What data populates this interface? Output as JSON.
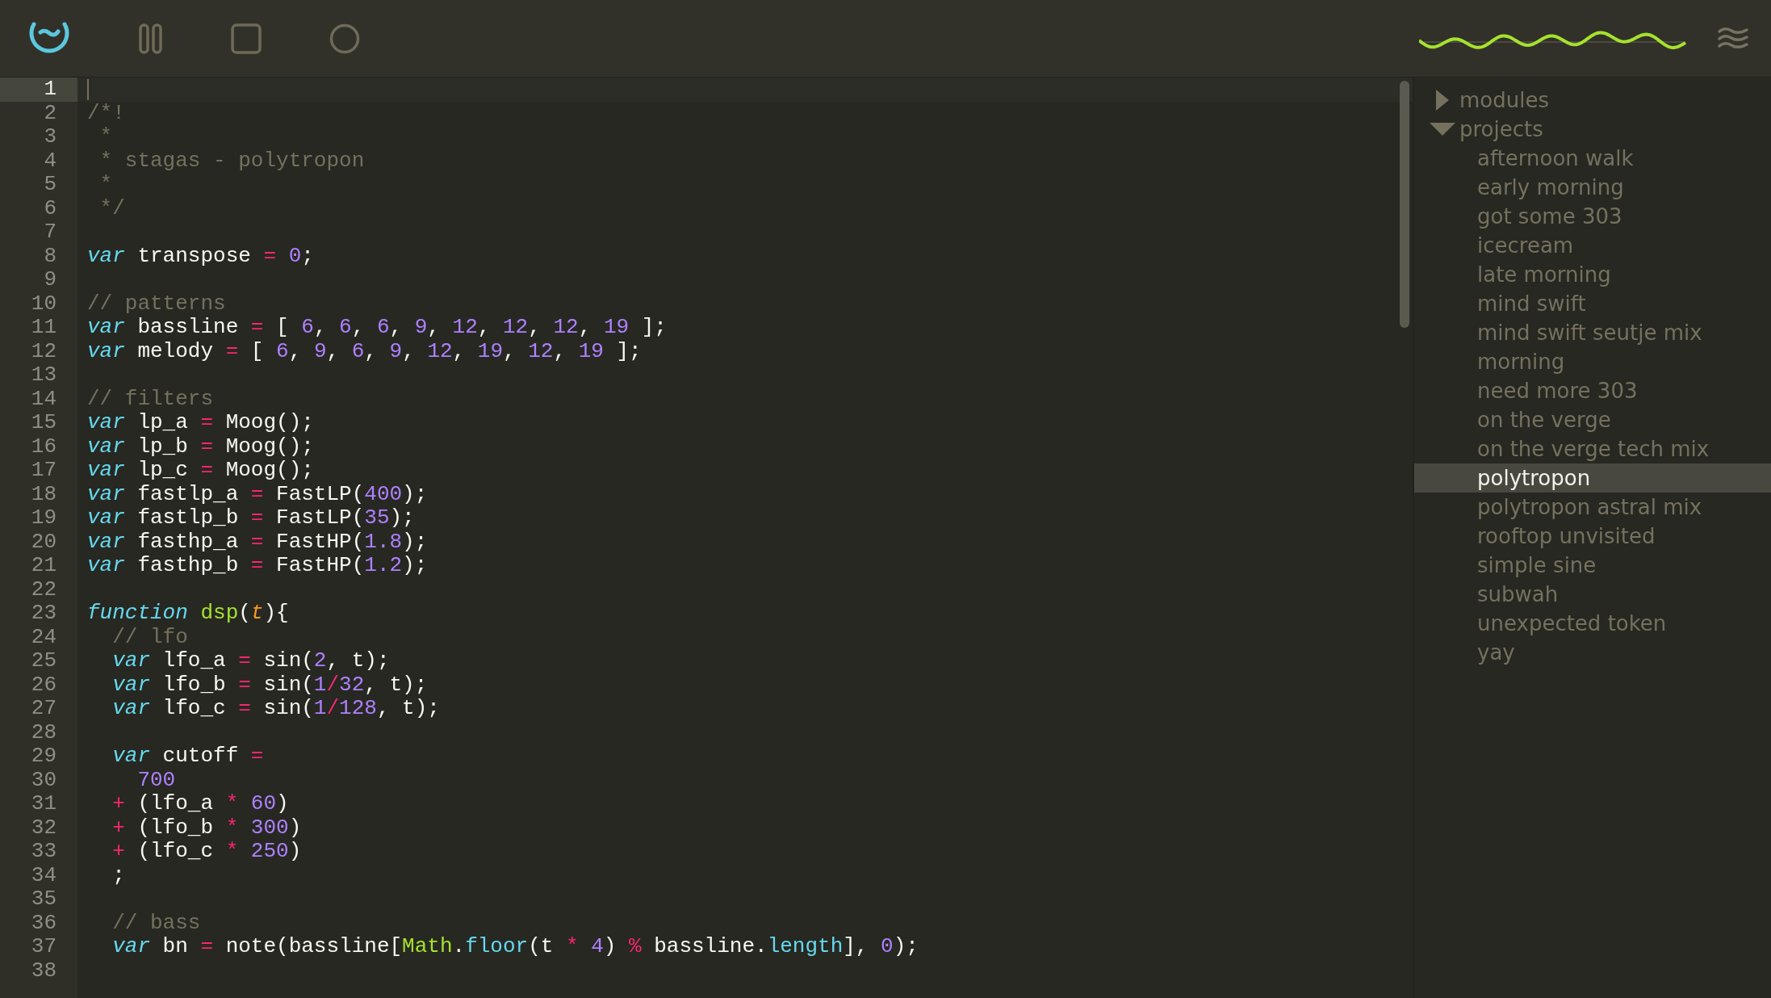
{
  "toolbar": {
    "buttons": [
      {
        "kind": "logo"
      },
      {
        "kind": "pause"
      },
      {
        "kind": "stop"
      },
      {
        "kind": "record"
      }
    ]
  },
  "editor": {
    "lines": [
      {
        "number": "1",
        "active": true
      },
      {
        "number": "2",
        "active": false,
        "tokens": [
          {
            "kind": "comment",
            "text": "/*!"
          }
        ]
      },
      {
        "number": "3",
        "active": false,
        "tokens": [
          {
            "kind": "comment",
            "text": " *"
          }
        ]
      },
      {
        "number": "4",
        "active": false,
        "tokens": [
          {
            "kind": "comment",
            "text": " * stagas - polytropon"
          }
        ]
      },
      {
        "number": "5",
        "active": false,
        "tokens": [
          {
            "kind": "comment",
            "text": " *"
          }
        ]
      },
      {
        "number": "6",
        "active": false,
        "tokens": [
          {
            "kind": "comment",
            "text": " */"
          }
        ]
      },
      {
        "number": "7",
        "active": false
      },
      {
        "number": "8",
        "active": false,
        "tokens": [
          {
            "kind": "keyword",
            "text": "var"
          },
          {
            "kind": "plain",
            "text": " transpose "
          },
          {
            "kind": "operator",
            "text": "= "
          },
          {
            "kind": "number",
            "text": "0"
          },
          {
            "kind": "plain",
            "text": ";"
          }
        ]
      },
      {
        "number": "9",
        "active": false
      },
      {
        "number": "10",
        "active": false,
        "tokens": [
          {
            "kind": "comment",
            "text": "// patterns"
          }
        ]
      },
      {
        "number": "11",
        "active": false,
        "tokens": [
          {
            "kind": "keyword",
            "text": "var"
          },
          {
            "kind": "plain",
            "text": " bassline "
          },
          {
            "kind": "operator",
            "text": "="
          },
          {
            "kind": "plain",
            "text": " [ "
          },
          {
            "kind": "number",
            "text": "6"
          },
          {
            "kind": "plain",
            "text": ", "
          },
          {
            "kind": "number",
            "text": "6"
          },
          {
            "kind": "plain",
            "text": ", "
          },
          {
            "kind": "number",
            "text": "6"
          },
          {
            "kind": "plain",
            "text": ", "
          },
          {
            "kind": "number",
            "text": "9"
          },
          {
            "kind": "plain",
            "text": ", "
          },
          {
            "kind": "number",
            "text": "12"
          },
          {
            "kind": "plain",
            "text": ", "
          },
          {
            "kind": "number",
            "text": "12"
          },
          {
            "kind": "plain",
            "text": ", "
          },
          {
            "kind": "number",
            "text": "12"
          },
          {
            "kind": "plain",
            "text": ", "
          },
          {
            "kind": "number",
            "text": "19"
          },
          {
            "kind": "plain",
            "text": " ];"
          }
        ]
      },
      {
        "number": "12",
        "active": false,
        "tokens": [
          {
            "kind": "keyword",
            "text": "var"
          },
          {
            "kind": "plain",
            "text": " melody "
          },
          {
            "kind": "operator",
            "text": "="
          },
          {
            "kind": "plain",
            "text": " [ "
          },
          {
            "kind": "number",
            "text": "6"
          },
          {
            "kind": "plain",
            "text": ", "
          },
          {
            "kind": "number",
            "text": "9"
          },
          {
            "kind": "plain",
            "text": ", "
          },
          {
            "kind": "number",
            "text": "6"
          },
          {
            "kind": "plain",
            "text": ", "
          },
          {
            "kind": "number",
            "text": "9"
          },
          {
            "kind": "plain",
            "text": ", "
          },
          {
            "kind": "number",
            "text": "12"
          },
          {
            "kind": "plain",
            "text": ", "
          },
          {
            "kind": "number",
            "text": "19"
          },
          {
            "kind": "plain",
            "text": ", "
          },
          {
            "kind": "number",
            "text": "12"
          },
          {
            "kind": "plain",
            "text": ", "
          },
          {
            "kind": "number",
            "text": "19"
          },
          {
            "kind": "plain",
            "text": " ];"
          }
        ]
      },
      {
        "number": "13",
        "active": false
      },
      {
        "number": "14",
        "active": false,
        "tokens": [
          {
            "kind": "comment",
            "text": "// filters"
          }
        ]
      },
      {
        "number": "15",
        "active": false,
        "tokens": [
          {
            "kind": "keyword",
            "text": "var"
          },
          {
            "kind": "plain",
            "text": " lp_a "
          },
          {
            "kind": "operator",
            "text": "="
          },
          {
            "kind": "plain",
            "text": " Moog();"
          }
        ]
      },
      {
        "number": "16",
        "active": false,
        "tokens": [
          {
            "kind": "keyword",
            "text": "var"
          },
          {
            "kind": "plain",
            "text": " lp_b "
          },
          {
            "kind": "operator",
            "text": "="
          },
          {
            "kind": "plain",
            "text": " Moog();"
          }
        ]
      },
      {
        "number": "17",
        "active": false,
        "tokens": [
          {
            "kind": "keyword",
            "text": "var"
          },
          {
            "kind": "plain",
            "text": " lp_c "
          },
          {
            "kind": "operator",
            "text": "="
          },
          {
            "kind": "plain",
            "text": " Moog();"
          }
        ]
      },
      {
        "number": "18",
        "active": false,
        "tokens": [
          {
            "kind": "keyword",
            "text": "var"
          },
          {
            "kind": "plain",
            "text": " fastlp_a "
          },
          {
            "kind": "operator",
            "text": "="
          },
          {
            "kind": "plain",
            "text": " FastLP("
          },
          {
            "kind": "number",
            "text": "400"
          },
          {
            "kind": "plain",
            "text": ");"
          }
        ]
      },
      {
        "number": "19",
        "active": false,
        "tokens": [
          {
            "kind": "keyword",
            "text": "var"
          },
          {
            "kind": "plain",
            "text": " fastlp_b "
          },
          {
            "kind": "operator",
            "text": "="
          },
          {
            "kind": "plain",
            "text": " FastLP("
          },
          {
            "kind": "number",
            "text": "35"
          },
          {
            "kind": "plain",
            "text": ");"
          }
        ]
      },
      {
        "number": "20",
        "active": false,
        "tokens": [
          {
            "kind": "keyword",
            "text": "var"
          },
          {
            "kind": "plain",
            "text": " fasthp_a "
          },
          {
            "kind": "operator",
            "text": "="
          },
          {
            "kind": "plain",
            "text": " FastHP("
          },
          {
            "kind": "number",
            "text": "1.8"
          },
          {
            "kind": "plain",
            "text": ");"
          }
        ]
      },
      {
        "number": "21",
        "active": false,
        "tokens": [
          {
            "kind": "keyword",
            "text": "var"
          },
          {
            "kind": "plain",
            "text": " fasthp_b "
          },
          {
            "kind": "operator",
            "text": "="
          },
          {
            "kind": "plain",
            "text": " FastHP("
          },
          {
            "kind": "number",
            "text": "1.2"
          },
          {
            "kind": "plain",
            "text": ");"
          }
        ]
      },
      {
        "number": "22",
        "active": false
      },
      {
        "number": "23",
        "active": false,
        "tokens": [
          {
            "kind": "keyword",
            "text": "function "
          },
          {
            "kind": "function",
            "text": "dsp"
          },
          {
            "kind": "plain",
            "text": "("
          },
          {
            "kind": "param",
            "text": "t"
          },
          {
            "kind": "plain",
            "text": "){"
          }
        ]
      },
      {
        "number": "24",
        "active": false,
        "tokens": [
          {
            "kind": "comment",
            "text": "  // lfo"
          }
        ]
      },
      {
        "number": "25",
        "active": false,
        "tokens": [
          {
            "kind": "keyword",
            "text": "  var"
          },
          {
            "kind": "plain",
            "text": " lfo_a "
          },
          {
            "kind": "operator",
            "text": "="
          },
          {
            "kind": "plain",
            "text": " sin("
          },
          {
            "kind": "number",
            "text": "2"
          },
          {
            "kind": "plain",
            "text": ", t);"
          }
        ]
      },
      {
        "number": "26",
        "active": false,
        "tokens": [
          {
            "kind": "keyword",
            "text": "  var"
          },
          {
            "kind": "plain",
            "text": " lfo_b "
          },
          {
            "kind": "operator",
            "text": "="
          },
          {
            "kind": "plain",
            "text": " sin("
          },
          {
            "kind": "number",
            "text": "1"
          },
          {
            "kind": "operator",
            "text": "/"
          },
          {
            "kind": "number",
            "text": "32"
          },
          {
            "kind": "plain",
            "text": ", t);"
          }
        ]
      },
      {
        "number": "27",
        "active": false,
        "tokens": [
          {
            "kind": "keyword",
            "text": "  var"
          },
          {
            "kind": "plain",
            "text": " lfo_c "
          },
          {
            "kind": "operator",
            "text": "="
          },
          {
            "kind": "plain",
            "text": " sin("
          },
          {
            "kind": "number",
            "text": "1"
          },
          {
            "kind": "operator",
            "text": "/"
          },
          {
            "kind": "number",
            "text": "128"
          },
          {
            "kind": "plain",
            "text": ", t);"
          }
        ]
      },
      {
        "number": "28",
        "active": false
      },
      {
        "number": "29",
        "active": false,
        "tokens": [
          {
            "kind": "keyword",
            "text": "  var"
          },
          {
            "kind": "plain",
            "text": " cutoff "
          },
          {
            "kind": "operator",
            "text": "="
          }
        ]
      },
      {
        "number": "30",
        "active": false,
        "tokens": [
          {
            "kind": "number",
            "text": "    700"
          }
        ]
      },
      {
        "number": "31",
        "active": false,
        "tokens": [
          {
            "kind": "operator",
            "text": "  +"
          },
          {
            "kind": "plain",
            "text": " (lfo_a "
          },
          {
            "kind": "operator",
            "text": "* "
          },
          {
            "kind": "number",
            "text": "60"
          },
          {
            "kind": "plain",
            "text": ")"
          }
        ]
      },
      {
        "number": "32",
        "active": false,
        "tokens": [
          {
            "kind": "operator",
            "text": "  +"
          },
          {
            "kind": "plain",
            "text": " (lfo_b "
          },
          {
            "kind": "operator",
            "text": "* "
          },
          {
            "kind": "number",
            "text": "300"
          },
          {
            "kind": "plain",
            "text": ")"
          }
        ]
      },
      {
        "number": "33",
        "active": false,
        "tokens": [
          {
            "kind": "operator",
            "text": "  +"
          },
          {
            "kind": "plain",
            "text": " (lfo_c "
          },
          {
            "kind": "operator",
            "text": "* "
          },
          {
            "kind": "number",
            "text": "250"
          },
          {
            "kind": "plain",
            "text": ")"
          }
        ]
      },
      {
        "number": "34",
        "active": false,
        "tokens": [
          {
            "kind": "plain",
            "text": "  ;"
          }
        ]
      },
      {
        "number": "35",
        "active": false
      },
      {
        "number": "36",
        "active": false,
        "tokens": [
          {
            "kind": "comment",
            "text": "  // bass"
          }
        ]
      },
      {
        "number": "37",
        "active": false,
        "tokens": [
          {
            "kind": "keyword",
            "text": "  var"
          },
          {
            "kind": "plain",
            "text": " bn "
          },
          {
            "kind": "operator",
            "text": "="
          },
          {
            "kind": "plain",
            "text": " note(bassline["
          },
          {
            "kind": "function",
            "text": "Math"
          },
          {
            "kind": "plain",
            "text": "."
          },
          {
            "kind": "property",
            "text": "floor"
          },
          {
            "kind": "plain",
            "text": "(t "
          },
          {
            "kind": "operator",
            "text": "* "
          },
          {
            "kind": "number",
            "text": "4"
          },
          {
            "kind": "plain",
            "text": ") "
          },
          {
            "kind": "operator",
            "text": "%"
          },
          {
            "kind": "plain",
            "text": " bassline."
          },
          {
            "kind": "property",
            "text": "length"
          },
          {
            "kind": "plain",
            "text": "], "
          },
          {
            "kind": "number",
            "text": "0"
          },
          {
            "kind": "plain",
            "text": ");"
          }
        ]
      },
      {
        "number": "38",
        "active": false
      }
    ]
  },
  "sidebar": {
    "items": [
      {
        "label": "modules",
        "expanded": false,
        "selected": false
      },
      {
        "label": "projects",
        "expanded": true,
        "selected": false,
        "children": [
          {
            "label": "afternoon walk",
            "selected": false
          },
          {
            "label": "early morning",
            "selected": false
          },
          {
            "label": "got some 303",
            "selected": false
          },
          {
            "label": "icecream",
            "selected": false
          },
          {
            "label": "late morning",
            "selected": false
          },
          {
            "label": "mind swift",
            "selected": false
          },
          {
            "label": "mind swift seutje mix",
            "selected": false
          },
          {
            "label": "morning",
            "selected": false
          },
          {
            "label": "need more 303",
            "selected": false
          },
          {
            "label": "on the verge",
            "selected": false
          },
          {
            "label": "on the verge tech mix",
            "selected": false
          },
          {
            "label": "polytropon",
            "selected": true
          },
          {
            "label": "polytropon astral mix",
            "selected": false
          },
          {
            "label": "rooftop unvisited",
            "selected": false
          },
          {
            "label": "simple sine",
            "selected": false
          },
          {
            "label": "subwah",
            "selected": false
          },
          {
            "label": "unexpected token",
            "selected": false
          },
          {
            "label": "yay",
            "selected": false
          }
        ]
      }
    ]
  }
}
